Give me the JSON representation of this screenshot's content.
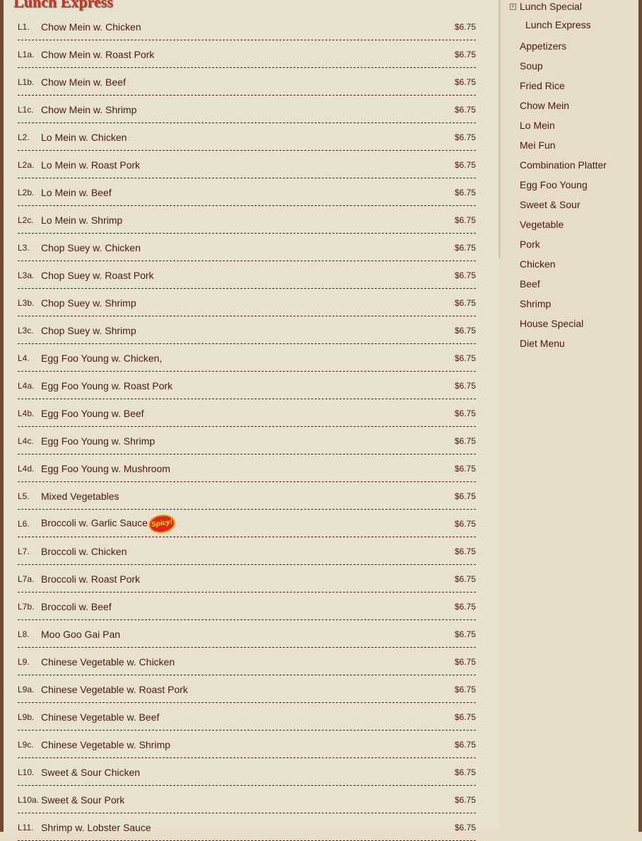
{
  "page": {
    "title": "Lunch Express"
  },
  "items": [
    {
      "code": "L1.",
      "name": "Chow Mein w. Chicken",
      "price": "$6.75"
    },
    {
      "code": "L1a.",
      "name": "Chow Mein w. Roast Pork",
      "price": "$6.75"
    },
    {
      "code": "L1b.",
      "name": "Chow Mein w. Beef",
      "price": "$6.75"
    },
    {
      "code": "L1c.",
      "name": "Chow Mein w. Shrimp",
      "price": "$6.75"
    },
    {
      "code": "L2.",
      "name": "Lo Mein w. Chicken",
      "price": "$6.75"
    },
    {
      "code": "L2a.",
      "name": "Lo Mein w. Roast Pork",
      "price": "$6.75"
    },
    {
      "code": "L2b.",
      "name": "Lo Mein w. Beef",
      "price": "$6.75"
    },
    {
      "code": "L2c.",
      "name": "Lo Mein w. Shrimp",
      "price": "$6.75"
    },
    {
      "code": "L3.",
      "name": "Chop Suey w. Chicken",
      "price": "$6.75"
    },
    {
      "code": "L3a.",
      "name": "Chop Suey w. Roast Pork",
      "price": "$6.75"
    },
    {
      "code": "L3b.",
      "name": "Chop Suey w. Shrimp",
      "price": "$6.75"
    },
    {
      "code": "L3c.",
      "name": "Chop Suey w. Shrimp",
      "price": "$6.75"
    },
    {
      "code": "L4.",
      "name": "Egg Foo Young w. Chicken,",
      "price": "$6.75"
    },
    {
      "code": "L4a.",
      "name": "Egg Foo Young w. Roast Pork",
      "price": "$6.75"
    },
    {
      "code": "L4b.",
      "name": "Egg Foo Young w. Beef",
      "price": "$6.75"
    },
    {
      "code": "L4c.",
      "name": "Egg Foo Young w. Shrimp",
      "price": "$6.75"
    },
    {
      "code": "L4d.",
      "name": "Egg Foo Young w. Mushroom",
      "price": "$6.75"
    },
    {
      "code": "L5.",
      "name": "Mixed Vegetables",
      "price": "$6.75"
    },
    {
      "code": "L6.",
      "name": "Broccoli w. Garlic Sauce",
      "price": "$6.75",
      "spicy": true,
      "badge": "Spicy!"
    },
    {
      "code": "L7.",
      "name": "Broccoli w. Chicken",
      "price": "$6.75"
    },
    {
      "code": "L7a.",
      "name": "Broccoli w. Roast Pork",
      "price": "$6.75"
    },
    {
      "code": "L7b.",
      "name": "Broccoli w. Beef",
      "price": "$6.75"
    },
    {
      "code": "L8.",
      "name": "Moo Goo Gai Pan",
      "price": "$6.75"
    },
    {
      "code": "L9.",
      "name": "Chinese Vegetable w. Chicken",
      "price": "$6.75"
    },
    {
      "code": "L9a.",
      "name": "Chinese Vegetable w. Roast Pork",
      "price": "$6.75"
    },
    {
      "code": "L9b.",
      "name": "Chinese Vegetable w. Beef",
      "price": "$6.75"
    },
    {
      "code": "L9c.",
      "name": "Chinese Vegetable w. Shrimp",
      "price": "$6.75"
    },
    {
      "code": "L10.",
      "name": "Sweet & Sour Chicken",
      "price": "$6.75"
    },
    {
      "code": "L10a.",
      "name": "Sweet & Sour Pork",
      "price": "$6.75"
    },
    {
      "code": "L11.",
      "name": "Shrimp w. Lobster Sauce",
      "price": "$6.75"
    }
  ],
  "sidebar": {
    "expander_symbol": "+",
    "parent": "Lunch Special",
    "child": "Lunch Express",
    "categories": [
      "Appetizers",
      "Soup",
      "Fried Rice",
      "Chow Mein",
      "Lo Mein",
      "Mei Fun",
      "Combination Platter",
      "Egg Foo Young",
      "Sweet & Sour",
      "Vegetable",
      "Pork",
      "Chicken",
      "Beef",
      "Shrimp",
      "House Special",
      "Diet Menu"
    ]
  },
  "colors": {
    "title": "#c0392b",
    "text": "#4a1a08",
    "spicy_badge": "#d8281e"
  },
  "icons": {
    "expander": "expand-icon",
    "spicy": "spicy-icon"
  }
}
